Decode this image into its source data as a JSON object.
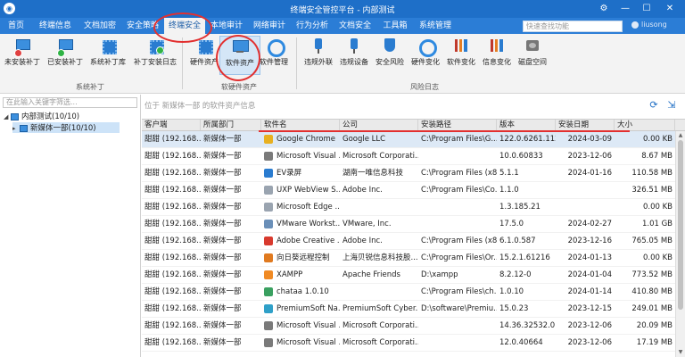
{
  "window": {
    "title": "终端安全管控平台 - 内部测试",
    "buttons": [
      "⚙",
      "—",
      "☐",
      "✕"
    ]
  },
  "menu": {
    "tabs": [
      "首页",
      "终端信息",
      "文档加密",
      "安全策略",
      "终端安全",
      "本地审计",
      "网络审计",
      "行为分析",
      "文档安全",
      "工具箱",
      "系统管理"
    ],
    "active": "终端安全",
    "search_placeholder": "快速查找功能",
    "user": "liusong"
  },
  "ribbon": {
    "buttons": [
      {
        "label": "未安装补丁",
        "icon": "laptop-icon",
        "group": "patch"
      },
      {
        "label": "已安装补丁",
        "icon": "laptop-check-icon",
        "group": "patch"
      },
      {
        "label": "系统补丁库",
        "icon": "patch-library-icon",
        "group": "patch"
      },
      {
        "label": "补丁安装日志",
        "icon": "patch-log-icon",
        "group": "patch"
      },
      {
        "label": "硬件资产",
        "icon": "hardware-chip-icon",
        "group": "asset"
      },
      {
        "label": "软件资产",
        "icon": "software-monitor-icon",
        "group": "asset"
      },
      {
        "label": "软件管理",
        "icon": "software-gear-icon",
        "group": "asset"
      },
      {
        "label": "违规外联",
        "icon": "outbound-link-icon",
        "group": "risk"
      },
      {
        "label": "违规设备",
        "icon": "device-icon",
        "group": "risk"
      },
      {
        "label": "安全风险",
        "icon": "security-risk-icon",
        "group": "risk"
      },
      {
        "label": "硬件变化",
        "icon": "hardware-change-icon",
        "group": "risk"
      },
      {
        "label": "软件变化",
        "icon": "software-change-icon",
        "group": "risk"
      },
      {
        "label": "信息变化",
        "icon": "info-change-icon",
        "group": "risk"
      },
      {
        "label": "磁盘空间",
        "icon": "disk-icon",
        "group": "risk"
      }
    ],
    "groups": [
      "系统补丁",
      "软硬件资产",
      "风险日志"
    ],
    "highlighted": "软件资产"
  },
  "tree": {
    "filter_placeholder": "在此输入关键字筛选...",
    "nodes": [
      {
        "label": "内部测试(10/10)",
        "arrow": "◢"
      },
      {
        "label": "新媒体一部(10/10)",
        "arrow": "▸"
      }
    ]
  },
  "table": {
    "search_placeholder": "位于 新媒体一部 的软件资产信息",
    "columns": [
      "客户端",
      "所属部门",
      "软件名",
      "公司",
      "安装路径",
      "版本",
      "安装日期",
      "大小"
    ],
    "rows": [
      {
        "client": "甜甜 (192.168...",
        "dept": "新媒体一部",
        "name": "Google Chrome",
        "company": "Google LLC",
        "path": "C:\\Program Files\\G...",
        "version": "122.0.6261.112",
        "date": "2024-03-09",
        "size": "0.00 KB",
        "icon_color": "#e8b020"
      },
      {
        "client": "甜甜 (192.168...",
        "dept": "新媒体一部",
        "name": "Microsoft Visual ...",
        "company": "Microsoft Corporati...",
        "path": "",
        "version": "10.0.60833",
        "date": "2023-12-06",
        "size": "8.67 MB",
        "icon_color": "#7a7a7a"
      },
      {
        "client": "甜甜 (192.168...",
        "dept": "新媒体一部",
        "name": "EV录屏",
        "company": "湖南一唯信息科技",
        "path": "C:\\Program Files (x8...",
        "version": "5.1.1",
        "date": "2024-01-16",
        "size": "110.58 MB",
        "icon_color": "#2a7cd0"
      },
      {
        "client": "甜甜 (192.168...",
        "dept": "新媒体一部",
        "name": "UXP WebView S...",
        "company": "Adobe Inc.",
        "path": "C:\\Program Files\\Co...",
        "version": "1.1.0",
        "date": "",
        "size": "326.51 MB",
        "icon_color": "#9aa4b0"
      },
      {
        "client": "甜甜 (192.168...",
        "dept": "新媒体一部",
        "name": "Microsoft Edge ...",
        "company": "",
        "path": "",
        "version": "1.3.185.21",
        "date": "",
        "size": "0.00 KB",
        "icon_color": "#9aa4b0"
      },
      {
        "client": "甜甜 (192.168...",
        "dept": "新媒体一部",
        "name": "VMware Workst...",
        "company": "VMware, Inc.",
        "path": "",
        "version": "17.5.0",
        "date": "2024-02-27",
        "size": "1.01 GB",
        "icon_color": "#6a8fb8"
      },
      {
        "client": "甜甜 (192.168...",
        "dept": "新媒体一部",
        "name": "Adobe Creative ...",
        "company": "Adobe Inc.",
        "path": "C:\\Program Files (x8...",
        "version": "6.1.0.587",
        "date": "2023-12-16",
        "size": "765.05 MB",
        "icon_color": "#d83a2e"
      },
      {
        "client": "甜甜 (192.168...",
        "dept": "新媒体一部",
        "name": "向日葵远程控制",
        "company": "上海贝锐信息科技股...",
        "path": "C:\\Program Files\\Or...",
        "version": "15.2.1.61216",
        "date": "2024-01-13",
        "size": "0.00 KB",
        "icon_color": "#e07a20"
      },
      {
        "client": "甜甜 (192.168...",
        "dept": "新媒体一部",
        "name": "XAMPP",
        "company": "Apache Friends",
        "path": "D:\\xampp",
        "version": "8.2.12-0",
        "date": "2024-01-04",
        "size": "773.52 MB",
        "icon_color": "#f08a24"
      },
      {
        "client": "甜甜 (192.168...",
        "dept": "新媒体一部",
        "name": "chataa 1.0.10",
        "company": "",
        "path": "C:\\Program Files\\ch...",
        "version": "1.0.10",
        "date": "2024-01-14",
        "size": "410.80 MB",
        "icon_color": "#3aa060"
      },
      {
        "client": "甜甜 (192.168...",
        "dept": "新媒体一部",
        "name": "PremiumSoft Na...",
        "company": "PremiumSoft Cyber...",
        "path": "D:\\software\\Premiu...",
        "version": "15.0.23",
        "date": "2023-12-15",
        "size": "249.01 MB",
        "icon_color": "#2fa0c8"
      },
      {
        "client": "甜甜 (192.168...",
        "dept": "新媒体一部",
        "name": "Microsoft Visual ...",
        "company": "Microsoft Corporati...",
        "path": "",
        "version": "14.36.32532.0",
        "date": "2023-12-06",
        "size": "20.09 MB",
        "icon_color": "#7a7a7a"
      },
      {
        "client": "甜甜 (192.168...",
        "dept": "新媒体一部",
        "name": "Microsoft Visual ...",
        "company": "Microsoft Corporati...",
        "path": "",
        "version": "12.0.40664",
        "date": "2023-12-06",
        "size": "17.19 MB",
        "icon_color": "#7a7a7a"
      }
    ]
  }
}
